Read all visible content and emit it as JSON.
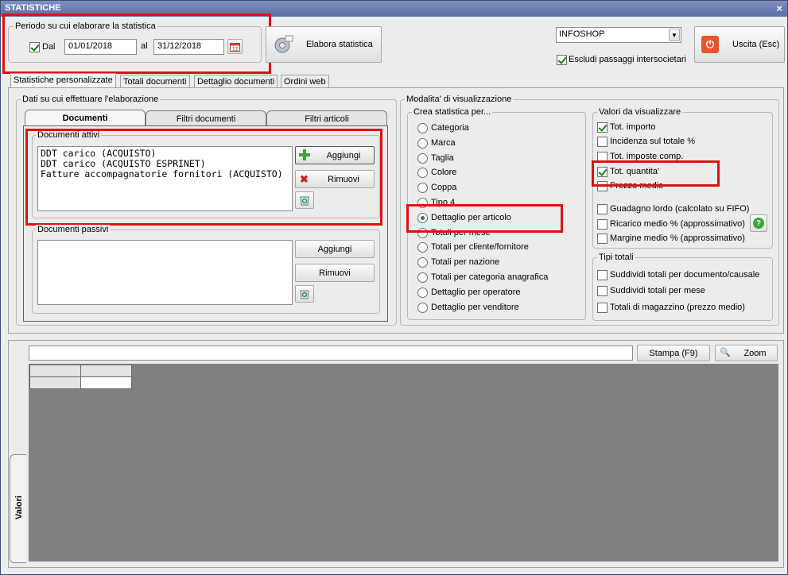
{
  "window": {
    "title": "STATISTICHE",
    "close": "×"
  },
  "period": {
    "group_title": "Periodo su cui elaborare la statistica",
    "dal_label": "Dal",
    "dal_checked": true,
    "from": "01/01/2018",
    "al_label": "al",
    "to": "31/12/2018"
  },
  "toolbar": {
    "elabora_label": "Elabora statistica",
    "uscita_label": "Uscita (Esc)"
  },
  "company": {
    "selected": "INFOSHOP",
    "exclude_label": "Escludi passaggi intersocietari",
    "exclude_checked": true
  },
  "tabs": [
    "Statistiche personalizzate",
    "Totali documenti",
    "Dettaglio documenti",
    "Ordini web"
  ],
  "data_group": {
    "title": "Dati su cui effettuare l'elaborazione",
    "subtabs": [
      "Documenti",
      "Filtri documenti",
      "Filtri articoli"
    ],
    "active": {
      "title": "Documenti attivi",
      "items": [
        "DDT carico (ACQUISTO)",
        "DDT carico (ACQUISTO ESPRINET)",
        "Fatture accompagnatorie fornitori (ACQUISTO)"
      ],
      "add": "Aggiungi",
      "remove": "Rimuovi"
    },
    "passive": {
      "title": "Documenti passivi",
      "items": [],
      "add": "Aggiungi",
      "remove": "Rimuovi"
    }
  },
  "view_mode": {
    "title": "Modalita' di visualizzazione",
    "create_title": "Crea statistica per...",
    "options": [
      "Categoria",
      "Marca",
      "Taglia",
      "Colore",
      "Coppa",
      "Tipo 4",
      "Dettaglio per articolo",
      "Totali per mese",
      "Totali per cliente/fornitore",
      "Totali per nazione",
      "Totali per categoria anagrafica",
      "Dettaglio per operatore",
      "Dettaglio per venditore"
    ],
    "selected_index": 6,
    "values_title": "Valori da visualizzare",
    "values": [
      {
        "label": "Tot. importo",
        "checked": true
      },
      {
        "label": "Incidenza sul totale %",
        "checked": false
      },
      {
        "label": "Tot. imposte comp.",
        "checked": false
      },
      {
        "label": "Tot. quantita'",
        "checked": true
      },
      {
        "label": "Prezzo medio",
        "checked": false
      },
      {
        "label": "Guadagno lordo (calcolato su FIFO)",
        "checked": false
      },
      {
        "label": "Ricarico medio % (approssimativo)",
        "checked": false
      },
      {
        "label": "Margine medio % (approssimativo)",
        "checked": false
      }
    ],
    "totals_title": "Tipi totali",
    "totals": [
      {
        "label": "Suddividi totali per documento/causale",
        "checked": false
      },
      {
        "label": "Suddividi totali per mese",
        "checked": false
      },
      {
        "label": "Totali di magazzino (prezzo medio)",
        "checked": false
      }
    ]
  },
  "results": {
    "filter_value": "",
    "print_label": "Stampa (F9)",
    "zoom_label": "Zoom",
    "side_tab": "Valori"
  },
  "colors": {
    "highlight": "#e01010",
    "grid_bg": "#808080",
    "title_bar": "#5a6ea6"
  }
}
